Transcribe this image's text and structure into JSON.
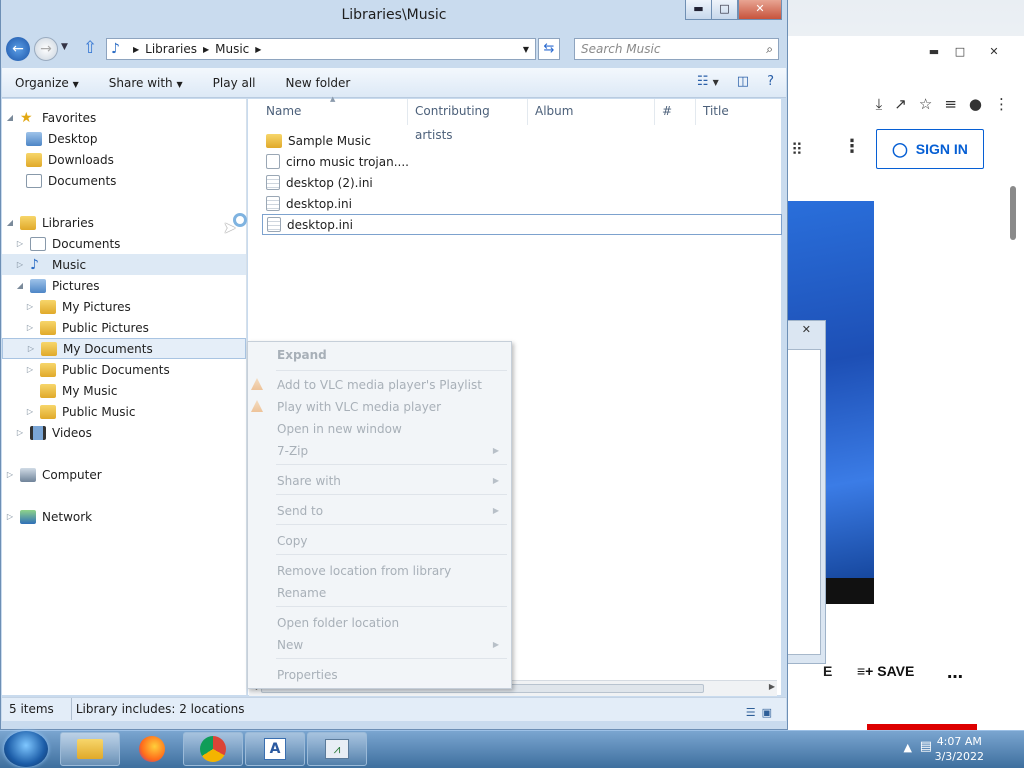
{
  "window": {
    "title": "Libraries\\Music",
    "minimize": "▬",
    "maximize": "□",
    "close": "✕"
  },
  "address": {
    "segments": [
      "Libraries",
      "Music"
    ],
    "search_placeholder": "Search Music"
  },
  "toolbar": {
    "organize": "Organize",
    "share_with": "Share with",
    "play_all": "Play all",
    "new_folder": "New folder"
  },
  "nav": {
    "favorites": "Favorites",
    "desktop": "Desktop",
    "downloads": "Downloads",
    "fav_documents": "Documents",
    "libraries": "Libraries",
    "lib_documents": "Documents",
    "music": "Music",
    "pictures": "Pictures",
    "my_pictures": "My Pictures",
    "public_pictures": "Public Pictures",
    "my_documents": "My Documents",
    "public_documents": "Public Documents",
    "my_music": "My Music",
    "public_music": "Public Music",
    "videos": "Videos",
    "computer": "Computer",
    "network": "Network"
  },
  "columns": [
    "Name",
    "Contributing artists",
    "Album",
    "#",
    "Title"
  ],
  "files": [
    {
      "name": "Sample Music",
      "type": "folder"
    },
    {
      "name": "cirno music trojan....",
      "type": "file"
    },
    {
      "name": "desktop (2).ini",
      "type": "ini"
    },
    {
      "name": "desktop.ini",
      "type": "ini"
    },
    {
      "name": "desktop.ini",
      "type": "ini"
    }
  ],
  "context_menu": {
    "expand": "Expand",
    "add_vlc": "Add to VLC media player's Playlist",
    "play_vlc": "Play with VLC media player",
    "open_new_window": "Open in new window",
    "zip": "7-Zip",
    "share_with": "Share with",
    "send_to": "Send to",
    "copy": "Copy",
    "remove_location": "Remove location from library",
    "rename": "Rename",
    "open_folder_location": "Open folder location",
    "new": "New",
    "properties": "Properties"
  },
  "status": {
    "items": "5 items",
    "library": "Library includes: 2 locations"
  },
  "browser": {
    "sign_in": "SIGN IN",
    "save": "SAVE",
    "partial_left": "E"
  },
  "clock": {
    "time": "4:07 AM",
    "date": "3/3/2022"
  },
  "colors": {
    "accent": "#065fd4",
    "selection": "#dde9f5",
    "taskbar": "#3e6f9e"
  }
}
